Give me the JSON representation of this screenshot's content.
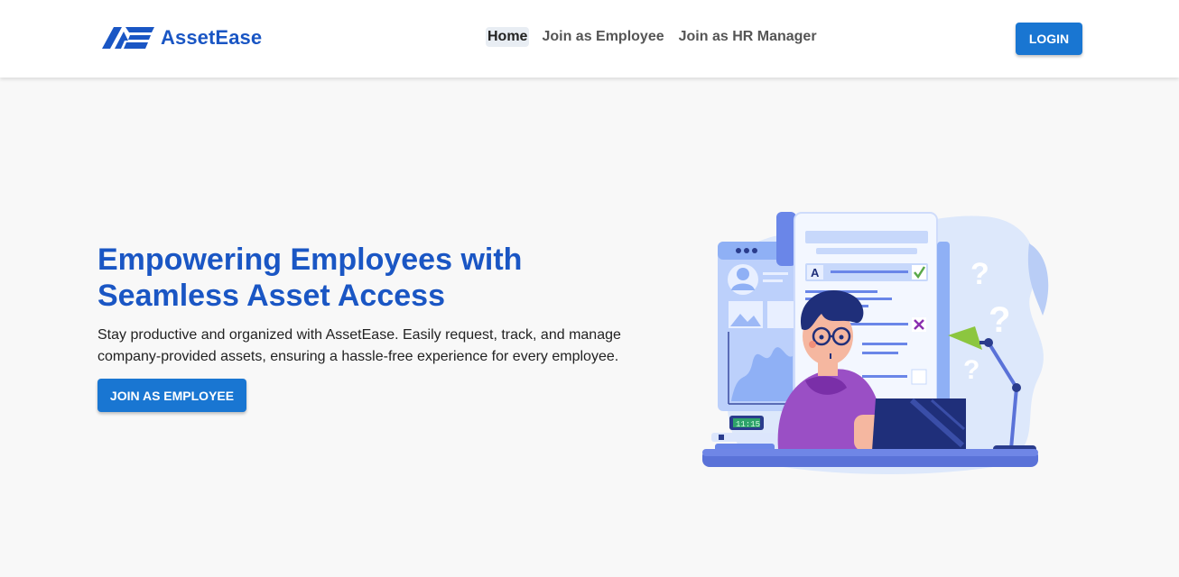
{
  "navbar": {
    "brand_name": "AssetEase",
    "links": [
      {
        "label": "Home",
        "active": true
      },
      {
        "label": "Join as Employee",
        "active": false
      },
      {
        "label": "Join as HR Manager",
        "active": false
      }
    ],
    "login_label": "LOGIN"
  },
  "hero": {
    "title": "Empowering Employees with Seamless Asset Access",
    "description": "Stay productive and organized with AssetEase. Easily request, track, and manage company-provided assets, ensuring a hassle-free experience for every employee.",
    "cta_label": "JOIN AS EMPLOYEE",
    "illustration": {
      "clock_text": "11:15",
      "card_letter": "A"
    }
  },
  "colors": {
    "brand": "#1a56c4",
    "button": "#1976d2",
    "page_background": "#f8f8f8"
  }
}
